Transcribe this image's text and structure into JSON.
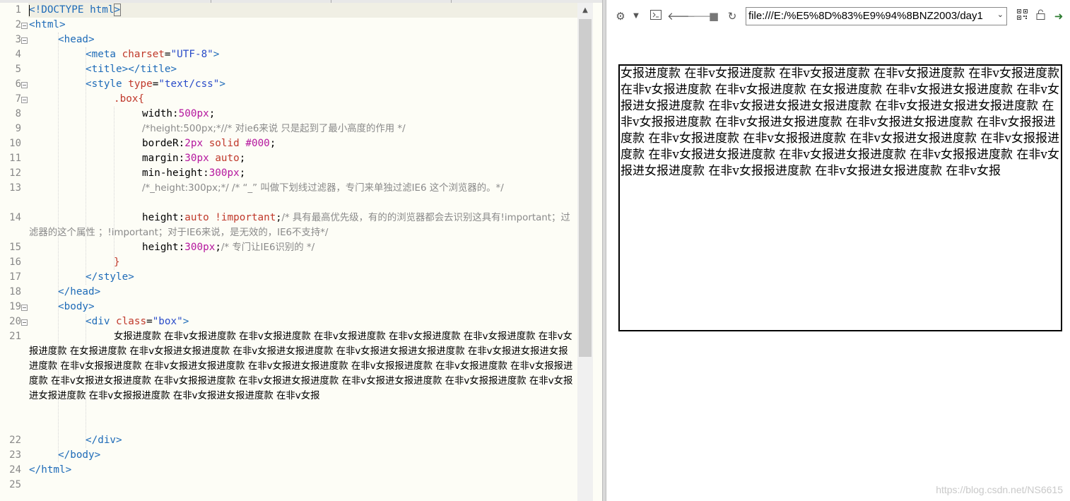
{
  "editor": {
    "line_numbers": [
      "1",
      "2",
      "3",
      "4",
      "5",
      "6",
      "7",
      "8",
      "9",
      "10",
      "11",
      "12",
      "13",
      "14",
      "15",
      "16",
      "17",
      "18",
      "19",
      "20",
      "21",
      "22",
      "23",
      "24",
      "25"
    ],
    "lines": {
      "l1_a": "<!DOCTYPE html",
      "l1_b": ">",
      "l2": "<html>",
      "l3": "<head>",
      "l4_tag": "<meta",
      "l4_attr": "charset",
      "l4_eq": "=",
      "l4_str": "\"UTF-8\"",
      "l4_end": ">",
      "l5": "<title></title>",
      "l6_tag": "<style",
      "l6_attr": "type",
      "l6_eq": "=",
      "l6_str": "\"text/css\"",
      "l6_end": ">",
      "l7": ".box{",
      "l8_prop": "width:",
      "l8_num": "500px",
      "l8_end": ";",
      "l9": "/*height:500px;*//* 对ie6来说 只是起到了最小高度的作用 */",
      "l10_prop": "bordeR:",
      "l10_num": "2px",
      "l10_kw": "solid",
      "l10_col": "#000",
      "l10_end": ";",
      "l11_prop": "margin:",
      "l11_num": "30px",
      "l11_kw": "auto",
      "l11_end": ";",
      "l12_prop": "min-height:",
      "l12_num": "300px",
      "l12_end": ";",
      "l13": "/*_height:300px;*/  /* “_”  叫做下划线过滤器，专门来单独过滤IE6 这个浏览器的。*/",
      "l14_prop": "height:",
      "l14_kw": "auto !important",
      "l14_end": ";",
      "l14_cmt": "/* 具有最高优先级，有的的浏览器都会去识别这具有!important；过滤器的这个属性 ；!important；对于IE6来说，是无效的，IE6不支持*/",
      "l15_prop": "height:",
      "l15_num": "300px",
      "l15_end": ";",
      "l15_cmt": "/* 专门让IE6识别的 */",
      "l16": "}",
      "l17": "</style>",
      "l18": "</head>",
      "l19": "<body>",
      "l20_tag": "<div",
      "l20_attr": "class",
      "l20_eq": "=",
      "l20_str": "\"box\"",
      "l20_end": ">",
      "l21": "女报进度款 在非v女报进度款 在非v女报进度款 在非v女报进度款 在非v女报进度款 在非v女报进度款 在非v女报进度款 在女报进度款 在非v女报进女报进度款 在非v女报进女报进度款 在非v女报进女报进女报进度款 在非v女报进女报进女报进度款 在非v女报报进度款 在非v女报进女报进度款 在非v女报进女报进度款 在非v女报报进度款 在非v女报进度款 在非v女报报进度款 在非v女报进女报进度款 在非v女报报进度款 在非v女报进女报进度款 在非v女报进女报进度款 在非v女报报进度款 在非v女报进女报进度款 在非v女报报进度款 在非v女报进女报进度款 在非v女报",
      "l22": "</div>",
      "l23": "</body>",
      "l24": "</html>"
    }
  },
  "browser": {
    "address": "file:///E:/%E5%8D%83%E9%94%8BNZ2003/day1",
    "box_text": "女报进度款 在非v女报进度款 在非v女报进度款 在非v女报进度款 在非v女报进度款 在非v女报进度款 在非v女报进度款 在女报进度款 在非v女报进女报进度款 在非v女报进女报进度款 在非v女报进女报进女报进度款 在非v女报进女报进女报进度款 在非v女报报进度款 在非v女报进女报进度款 在非v女报进女报进度款 在非v女报报进度款 在非v女报进度款 在非v女报报进度款 在非v女报进女报进度款 在非v女报报进度款 在非v女报进女报进度款 在非v女报进女报进度款 在非v女报报进度款 在非v女报进女报进度款 在非v女报报进度款 在非v女报进女报进度款 在非v女报",
    "icons": [
      "settings-icon",
      "dropdown-icon",
      "console-icon",
      "back-icon",
      "forward-icon",
      "stop-icon",
      "reload-icon",
      "qr-code-icon",
      "lock-icon",
      "go-icon"
    ]
  },
  "watermark": "https://blog.csdn.net/NS6615"
}
